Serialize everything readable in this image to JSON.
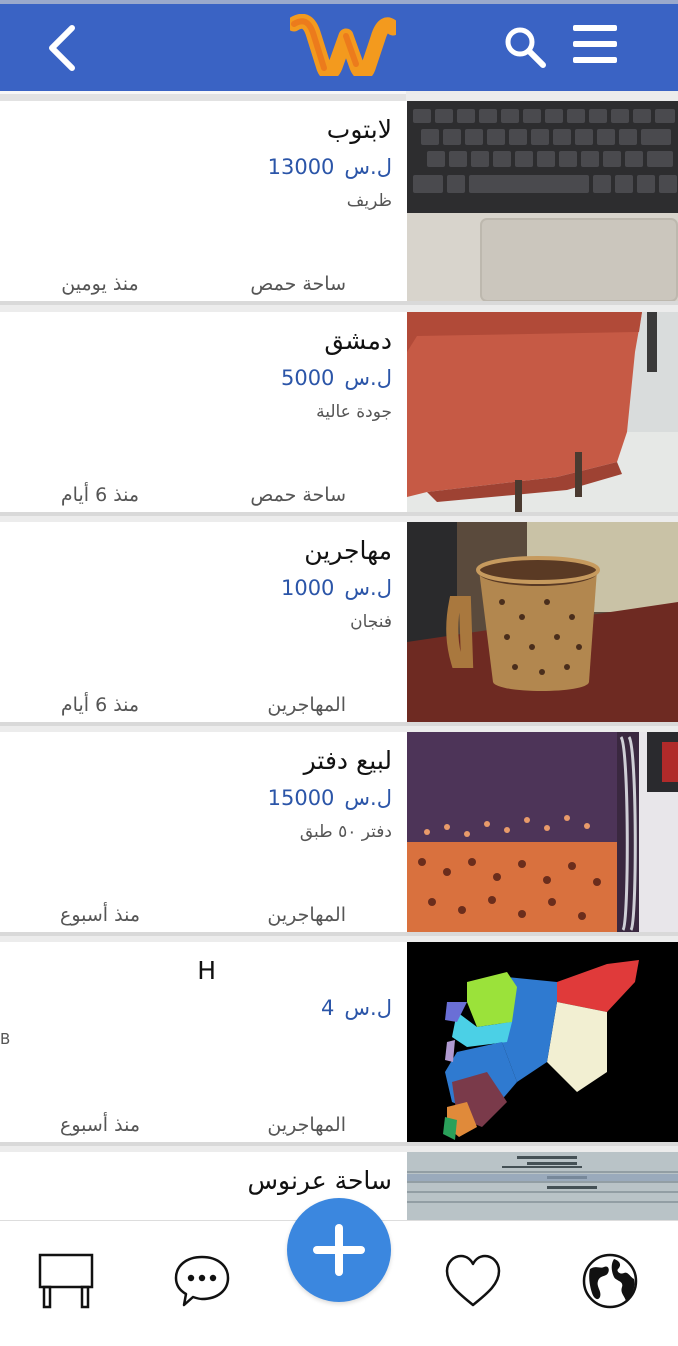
{
  "header": {
    "back_icon": "chevron-left-icon",
    "logo_icon": "app-logo-w",
    "search_icon": "search-icon",
    "menu_icon": "hamburger-menu-icon",
    "bar_color": "#3a63c4",
    "logo_color": "#f39a1e"
  },
  "listings": [
    {
      "title": "لابتوب",
      "price": "13000",
      "currency": "ل.س",
      "description": "ظريف",
      "location": "ساحة حمص",
      "time": "منذ يومين",
      "image": "laptop-keyboard-photo"
    },
    {
      "title": "دمشق",
      "price": "5000",
      "currency": "ل.س",
      "description": "جودة عالية",
      "location": "ساحة حمص",
      "time": "منذ 6 أيام",
      "image": "red-chair-photo"
    },
    {
      "title": "مهاجرين",
      "price": "1000",
      "currency": "ل.س",
      "description": "فنجان",
      "location": "المهاجرين",
      "time": "منذ 6 أيام",
      "image": "mug-photo"
    },
    {
      "title": "لبيع دفتر",
      "price": "15000",
      "currency": "ل.س",
      "description": "دفتر ٥٠ طبق",
      "location": "المهاجرين",
      "time": "منذ أسبوع",
      "image": "notebook-photo"
    },
    {
      "title": "H",
      "price": "4",
      "currency": "ل.س",
      "description": "B",
      "location": "المهاجرين",
      "time": "منذ أسبوع",
      "image": "syria-map-image"
    },
    {
      "title": "ساحة عرنوس",
      "price": "",
      "currency": "",
      "description": "",
      "location": "",
      "time": "",
      "image": "document-photo"
    }
  ],
  "bottom_nav": {
    "items": [
      {
        "name": "board-icon"
      },
      {
        "name": "chat-icon"
      },
      {
        "name": "add-icon"
      },
      {
        "name": "heart-icon"
      },
      {
        "name": "globe-icon"
      }
    ],
    "fab_color": "#3b87df"
  }
}
